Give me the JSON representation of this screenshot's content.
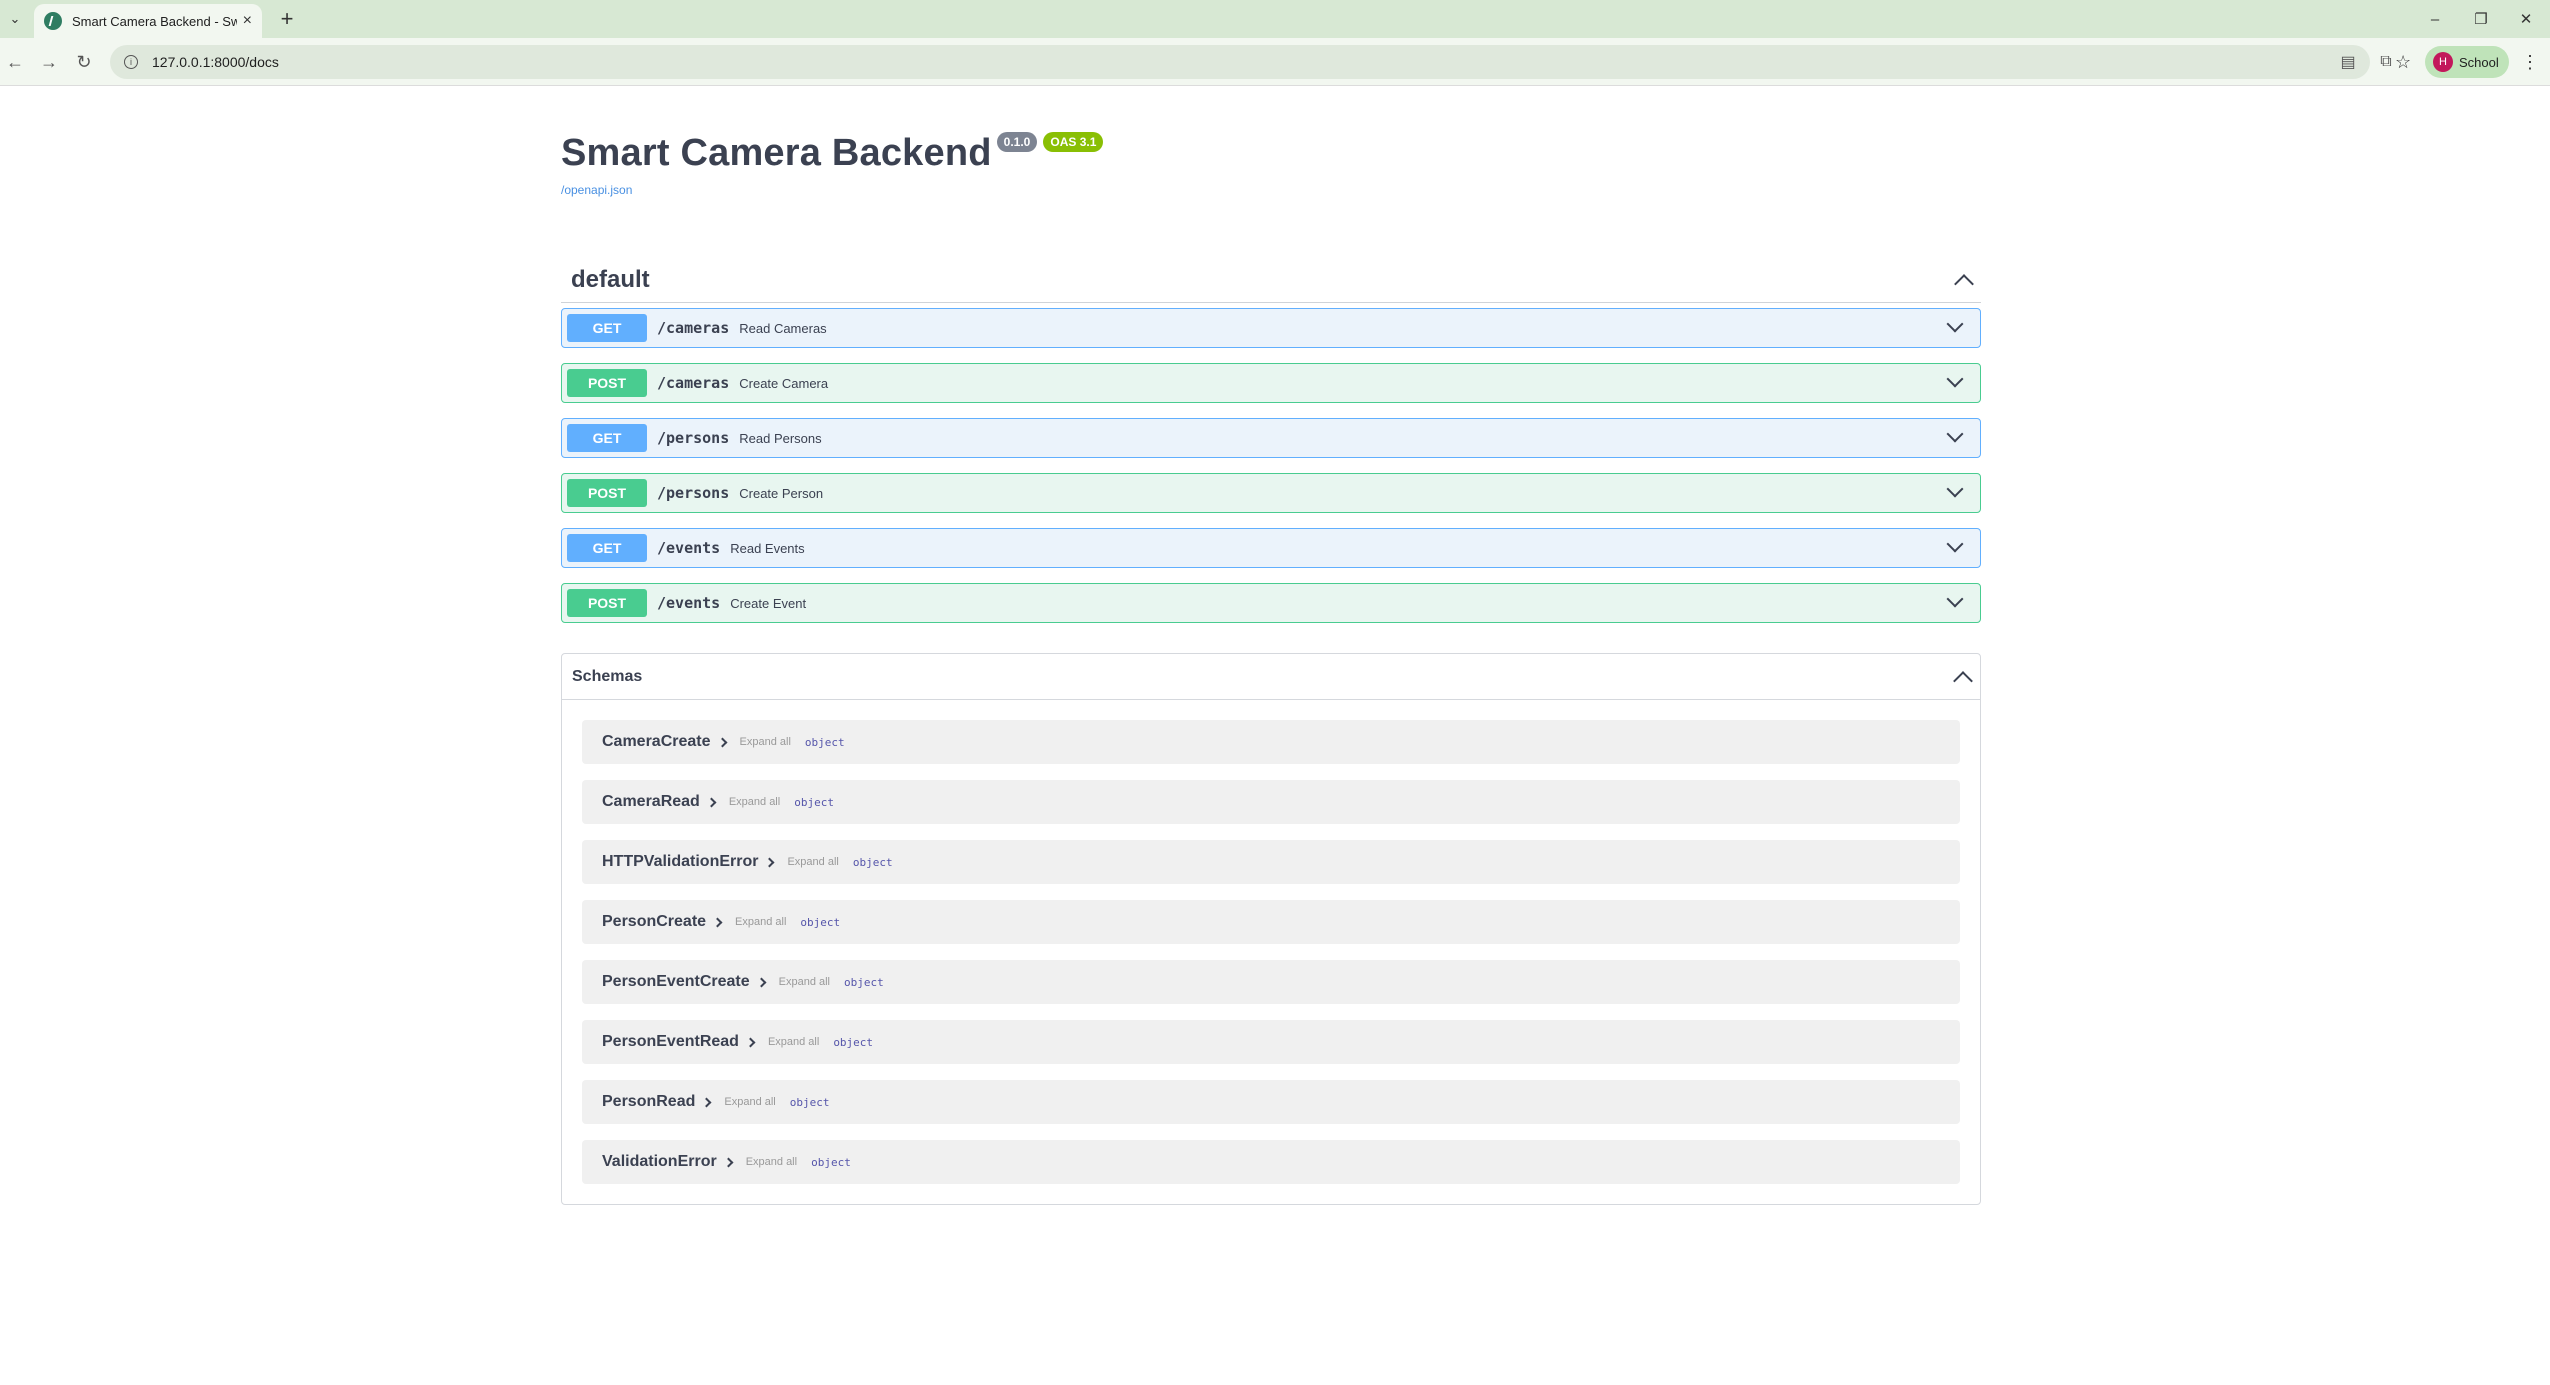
{
  "browser": {
    "tab_title": "Smart Camera Backend - Swagger UI",
    "new_tab": "+",
    "url": "127.0.0.1:8000/docs",
    "profile_initial": "H",
    "profile_name": "School"
  },
  "info": {
    "title": "Smart Camera Backend",
    "version": "0.1.0",
    "oas": "OAS 3.1",
    "spec_link": "/openapi.json"
  },
  "section": {
    "title": "default",
    "operations": [
      {
        "method": "GET",
        "path": "/cameras",
        "summary": "Read Cameras"
      },
      {
        "method": "POST",
        "path": "/cameras",
        "summary": "Create Camera"
      },
      {
        "method": "GET",
        "path": "/persons",
        "summary": "Read Persons"
      },
      {
        "method": "POST",
        "path": "/persons",
        "summary": "Create Person"
      },
      {
        "method": "GET",
        "path": "/events",
        "summary": "Read Events"
      },
      {
        "method": "POST",
        "path": "/events",
        "summary": "Create Event"
      }
    ]
  },
  "schemas": {
    "title": "Schemas",
    "expand_label": "Expand all",
    "type_label": "object",
    "items": [
      {
        "name": "CameraCreate"
      },
      {
        "name": "CameraRead"
      },
      {
        "name": "HTTPValidationError"
      },
      {
        "name": "PersonCreate"
      },
      {
        "name": "PersonEventCreate"
      },
      {
        "name": "PersonEventRead"
      },
      {
        "name": "PersonRead"
      },
      {
        "name": "ValidationError"
      }
    ]
  },
  "colors": {
    "get": "#61affe",
    "post": "#49cc90",
    "text": "#3b4151",
    "link": "#4990e2"
  }
}
